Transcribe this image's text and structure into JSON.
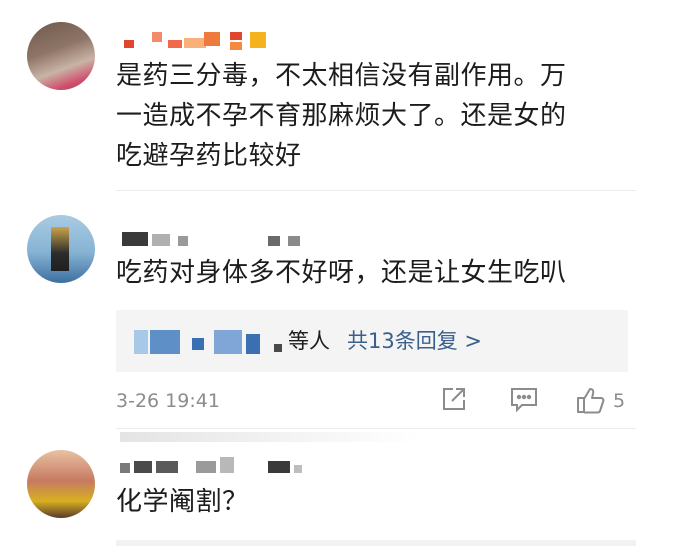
{
  "comments": [
    {
      "text_line1": "是药三分毒，不太相信没有副作用。万",
      "text_line2": "一造成不孕不育那麻烦大了。还是女的",
      "text_line3": "吃避孕药比较好"
    },
    {
      "text": "吃药对身体多不好呀，还是让女生吃叭",
      "replies": {
        "names_suffix": "等人",
        "link_text": "共13条回复 >"
      },
      "timestamp": "3-26 19:41",
      "like_count": "5"
    },
    {
      "text": "化学阉割？"
    }
  ],
  "colors": {
    "link": "#3a5f8c",
    "meta": "#8c8c8c",
    "reply_bg": "#f4f4f4"
  },
  "icons": [
    "share-icon",
    "comment-icon",
    "thumbs-up-icon"
  ]
}
